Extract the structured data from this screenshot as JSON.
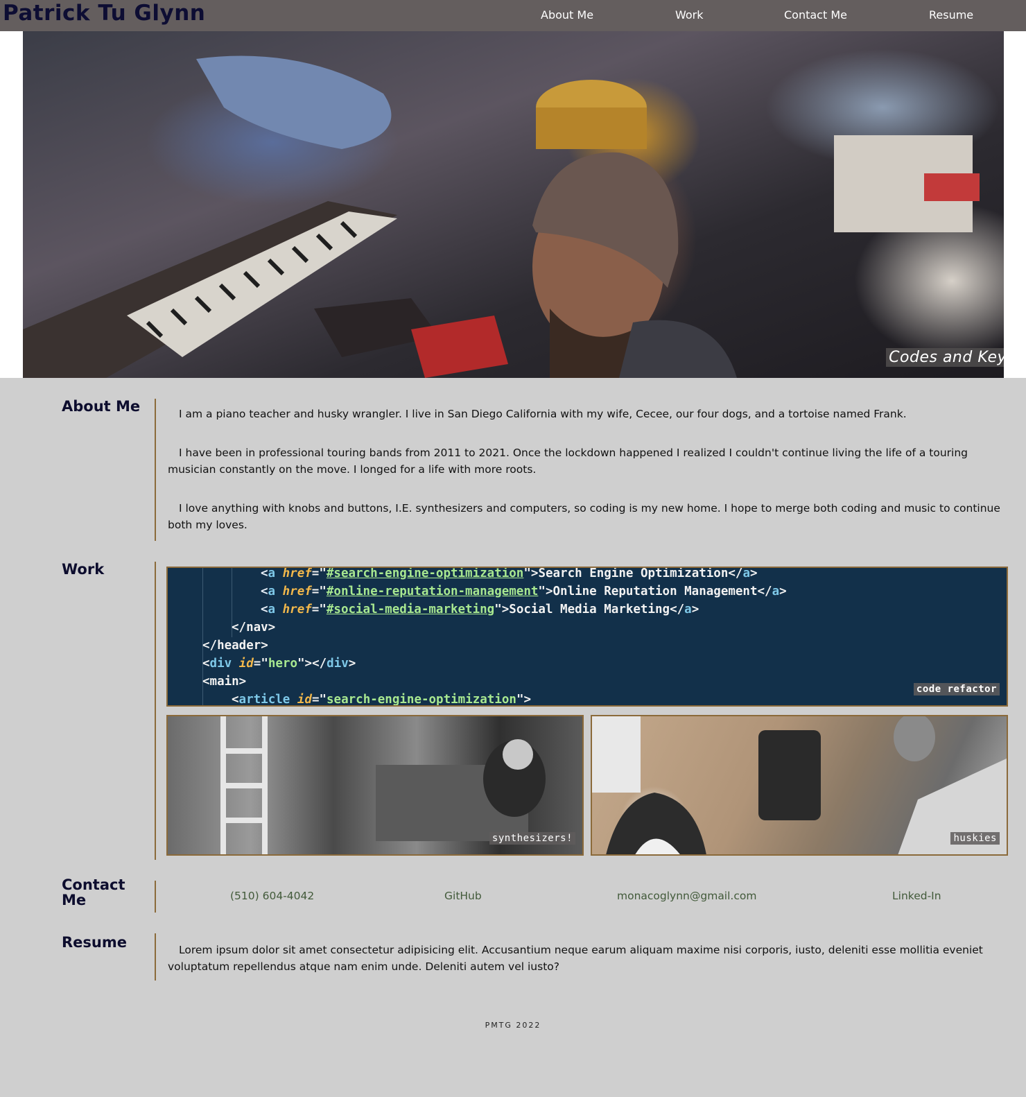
{
  "header": {
    "brand": "Patrick Tu Glynn",
    "nav": [
      {
        "label": "About Me"
      },
      {
        "label": "Work"
      },
      {
        "label": "Contact Me"
      },
      {
        "label": "Resume"
      }
    ]
  },
  "hero": {
    "caption": "Codes and Keys"
  },
  "about": {
    "title": "About Me",
    "paragraphs": [
      "I am a piano teacher and husky wrangler. I live in San Diego California with my wife, Cecee, our four dogs, and a tortoise named Frank.",
      "I have been in professional touring bands from 2011 to 2021. Once the lockdown happened I realized I couldn't continue living the life of a touring musician constantly on the move. I longed for a life with more roots.",
      "I love anything with knobs and buttons, I.E. synthesizers and computers, so coding is my new home. I hope to merge both coding and music to continue both my loves."
    ]
  },
  "work": {
    "title": "Work",
    "cards": [
      {
        "caption": "code refactor"
      },
      {
        "caption": "synthesizers!"
      },
      {
        "caption": "huskies"
      }
    ],
    "code": {
      "l1_open": "<",
      "l1_tag": "a",
      "l1_attr": "href",
      "l1_val": "#search-engine-optimization",
      "l1_text": "Search Engine Optimization",
      "l2_val": "#online-reputation-management",
      "l2_text": "Online Reputation Management",
      "l3_val": "#social-media-marketing",
      "l3_text": "Social Media Marketing",
      "l4": "</nav>",
      "l5": "</header>",
      "l6_tag": "div",
      "l6_attr": "id",
      "l6_val": "hero",
      "l7": "<main>",
      "l8_tag": "article",
      "l8_attr": "id",
      "l8_val": "search-engine-optimization"
    }
  },
  "contact": {
    "title": "Contact Me",
    "links": [
      {
        "label": "(510) 604-4042"
      },
      {
        "label": "GitHub"
      },
      {
        "label": "monacoglynn@gmail.com"
      },
      {
        "label": "Linked-In"
      }
    ]
  },
  "resume": {
    "title": "Resume",
    "text": "Lorem ipsum dolor sit amet consectetur adipisicing elit. Accusantium neque earum aliquam maxime nisi corporis, iusto, deleniti esse mollitia eveniet voluptatum repellendus atque nam enim unde. Deleniti autem vel iusto?"
  },
  "footer": {
    "text": "PMTG 2022"
  },
  "colors": {
    "header_bg": "#645e5e",
    "page_bg": "#cfcfcf",
    "accent_line": "#8b6a3a",
    "heading": "#0d0d2e",
    "contact_link": "#425a3a",
    "code_bg": "#12304a"
  }
}
